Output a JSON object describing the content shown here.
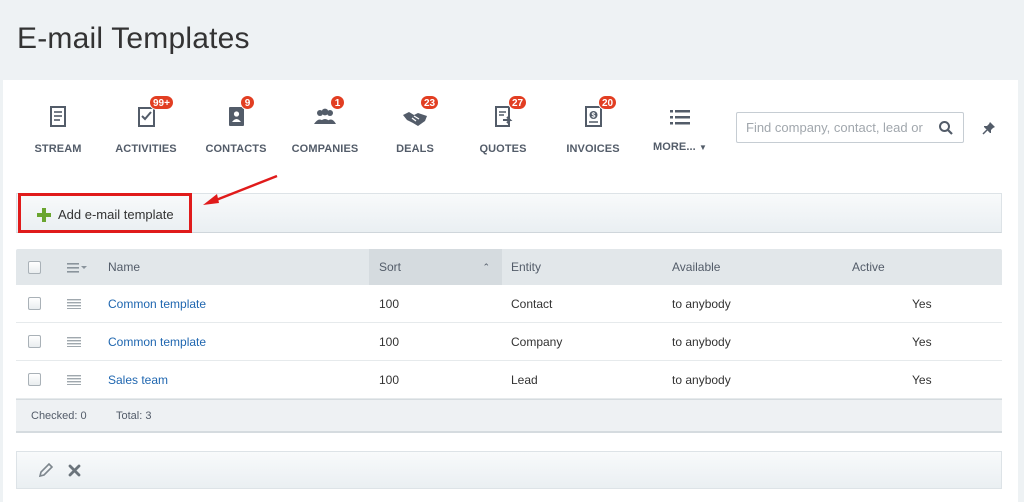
{
  "page_title": "E-mail Templates",
  "nav": {
    "items": [
      {
        "label": "STREAM",
        "badge": ""
      },
      {
        "label": "ACTIVITIES",
        "badge": "99+"
      },
      {
        "label": "CONTACTS",
        "badge": "9"
      },
      {
        "label": "COMPANIES",
        "badge": "1"
      },
      {
        "label": "DEALS",
        "badge": "23"
      },
      {
        "label": "QUOTES",
        "badge": "27"
      },
      {
        "label": "INVOICES",
        "badge": "20"
      },
      {
        "label": "MORE...",
        "badge": ""
      }
    ],
    "search_placeholder": "Find company, contact, lead or"
  },
  "toolbar": {
    "add_label": "Add e-mail template"
  },
  "grid": {
    "columns": [
      "Name",
      "Sort",
      "Entity",
      "Available",
      "Active"
    ],
    "rows": [
      {
        "name": "Common template",
        "sort": "100",
        "entity": "Contact",
        "available": "to anybody",
        "active": "Yes"
      },
      {
        "name": "Common template",
        "sort": "100",
        "entity": "Company",
        "available": "to anybody",
        "active": "Yes"
      },
      {
        "name": "Sales team",
        "sort": "100",
        "entity": "Lead",
        "available": "to anybody",
        "active": "Yes"
      }
    ],
    "footer": {
      "checked": "Checked: 0",
      "total": "Total: 3"
    }
  },
  "colors": {
    "accent_link": "#2067b0",
    "badge": "#e23e22",
    "highlight": "#e01b1b"
  }
}
